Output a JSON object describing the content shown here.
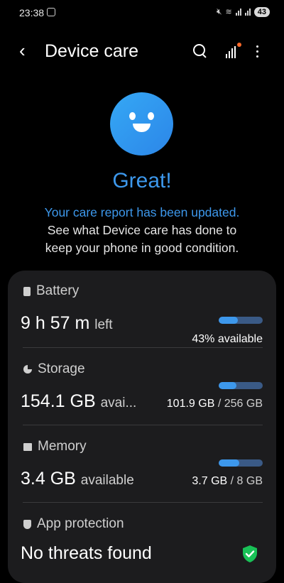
{
  "status_bar": {
    "time": "23:38",
    "battery": "43"
  },
  "header": {
    "title": "Device care",
    "back_icon": "chevron-left-icon",
    "search_icon": "search-icon",
    "stats_icon": "bar-chart-icon",
    "more_icon": "more-vert-icon"
  },
  "hero": {
    "headline": "Great!",
    "subline_blue": "Your care report has been updated.",
    "subline_line2": "See what Device care has done to",
    "subline_line3": "keep your phone in good condition."
  },
  "sections": {
    "battery": {
      "label": "Battery",
      "value": "9 h 57 m",
      "suffix": "left",
      "right": "43% available",
      "fill": 0.43
    },
    "storage": {
      "label": "Storage",
      "value": "154.1 GB",
      "suffix": "avai...",
      "used": "101.9 GB",
      "total": "/ 256 GB",
      "fill": 0.4
    },
    "memory": {
      "label": "Memory",
      "value": "3.4 GB",
      "suffix": "available",
      "used": "3.7 GB",
      "total": "/ 8 GB",
      "fill": 0.46
    },
    "app_protection": {
      "label": "App protection",
      "value": "No threats found"
    }
  },
  "colors": {
    "accent": "#3d98ec",
    "smiley": "#35a8f5",
    "card": "#1c1c1e",
    "ok_green": "#19c157"
  }
}
